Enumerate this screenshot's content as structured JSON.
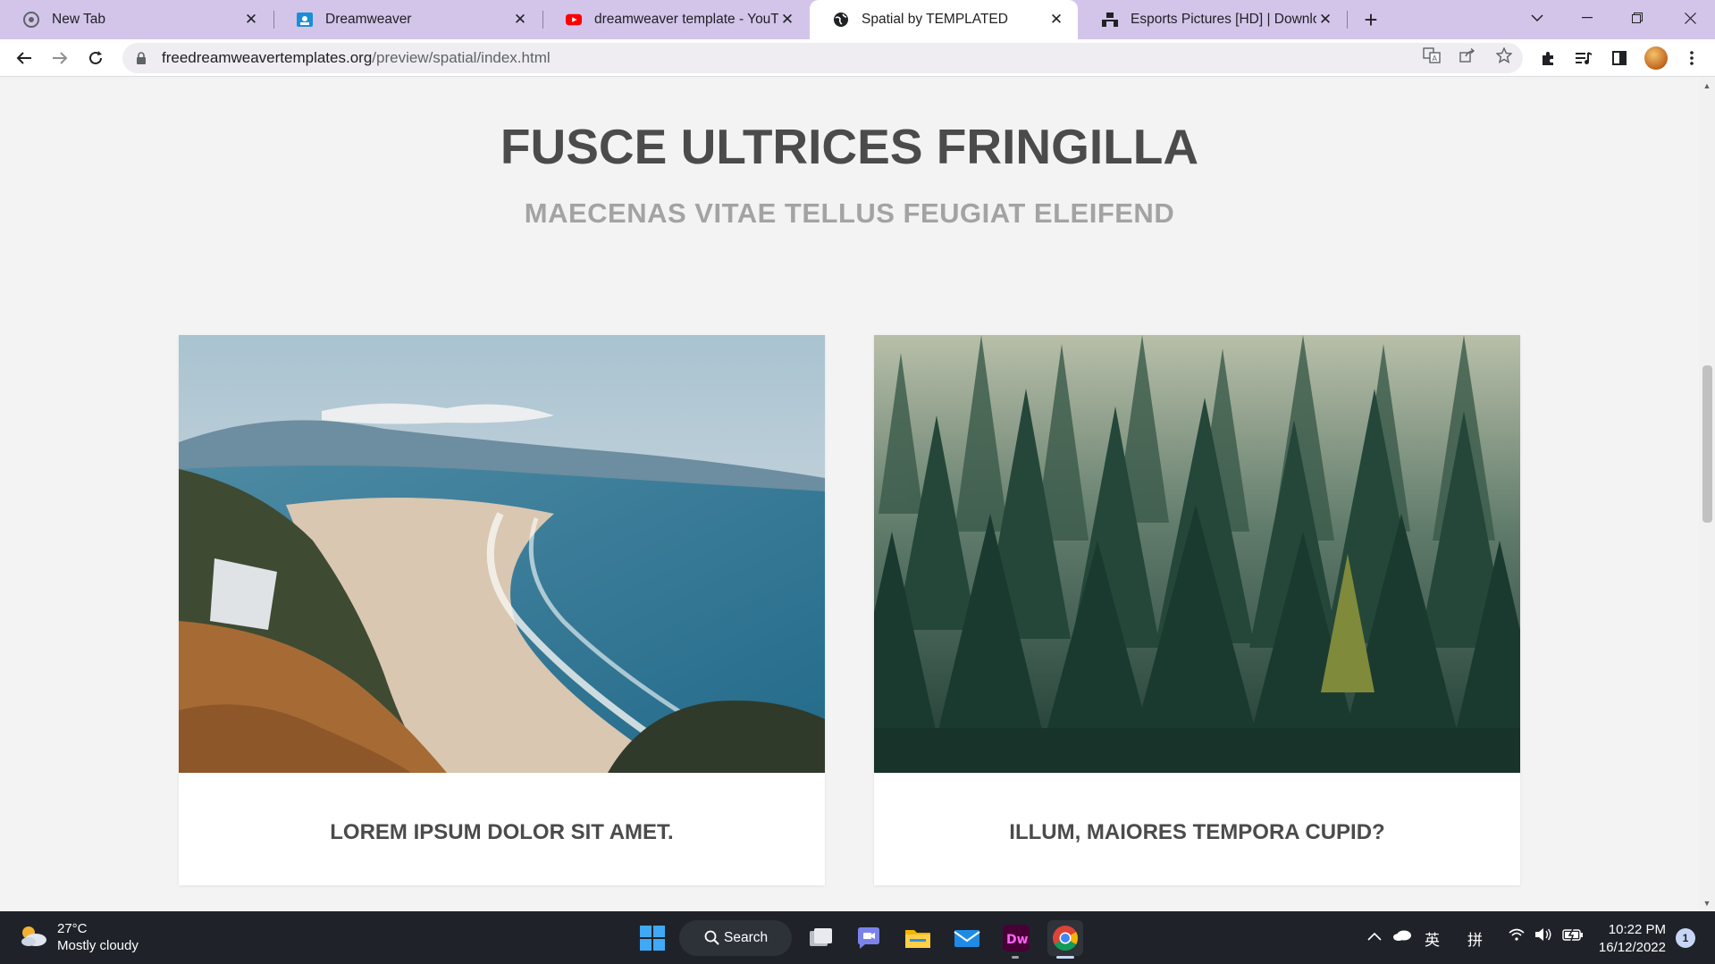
{
  "browser": {
    "tabs": [
      {
        "title": "New Tab",
        "icon": "chrome-icon",
        "active": false
      },
      {
        "title": "Dreamweaver",
        "icon": "classroom-icon",
        "active": false
      },
      {
        "title": "dreamweaver template - YouTube",
        "icon": "youtube-icon",
        "active": false
      },
      {
        "title": "Spatial by TEMPLATED",
        "icon": "globe-icon",
        "active": true
      },
      {
        "title": "Esports Pictures [HD] | Download",
        "icon": "unsplash-icon",
        "active": false
      }
    ],
    "url_host": "freedreamweavertemplates.org",
    "url_path": "/preview/spatial/index.html"
  },
  "page": {
    "headline": "FUSCE ULTRICES FRINGILLA",
    "subheadline": "MAECENAS VITAE TELLUS FEUGIAT ELEIFEND",
    "cards": [
      {
        "title": "LOREM IPSUM DOLOR SIT AMET.",
        "image": "coastal-beach-photo"
      },
      {
        "title": "ILLUM, MAIORES TEMPORA CUPID?",
        "image": "pine-forest-photo"
      }
    ]
  },
  "taskbar": {
    "weather_temp": "27°C",
    "weather_desc": "Mostly cloudy",
    "search_label": "Search",
    "tray_lang": "英",
    "tray_ime": "拼",
    "time": "10:22 PM",
    "date": "16/12/2022",
    "notification_count": "1"
  },
  "colors": {
    "tabstrip": "#d3c5ea",
    "page_bg": "#f3f3f3",
    "heading": "#4b4b4b",
    "subheading": "#a3a3a3",
    "taskbar": "#1f2329"
  }
}
